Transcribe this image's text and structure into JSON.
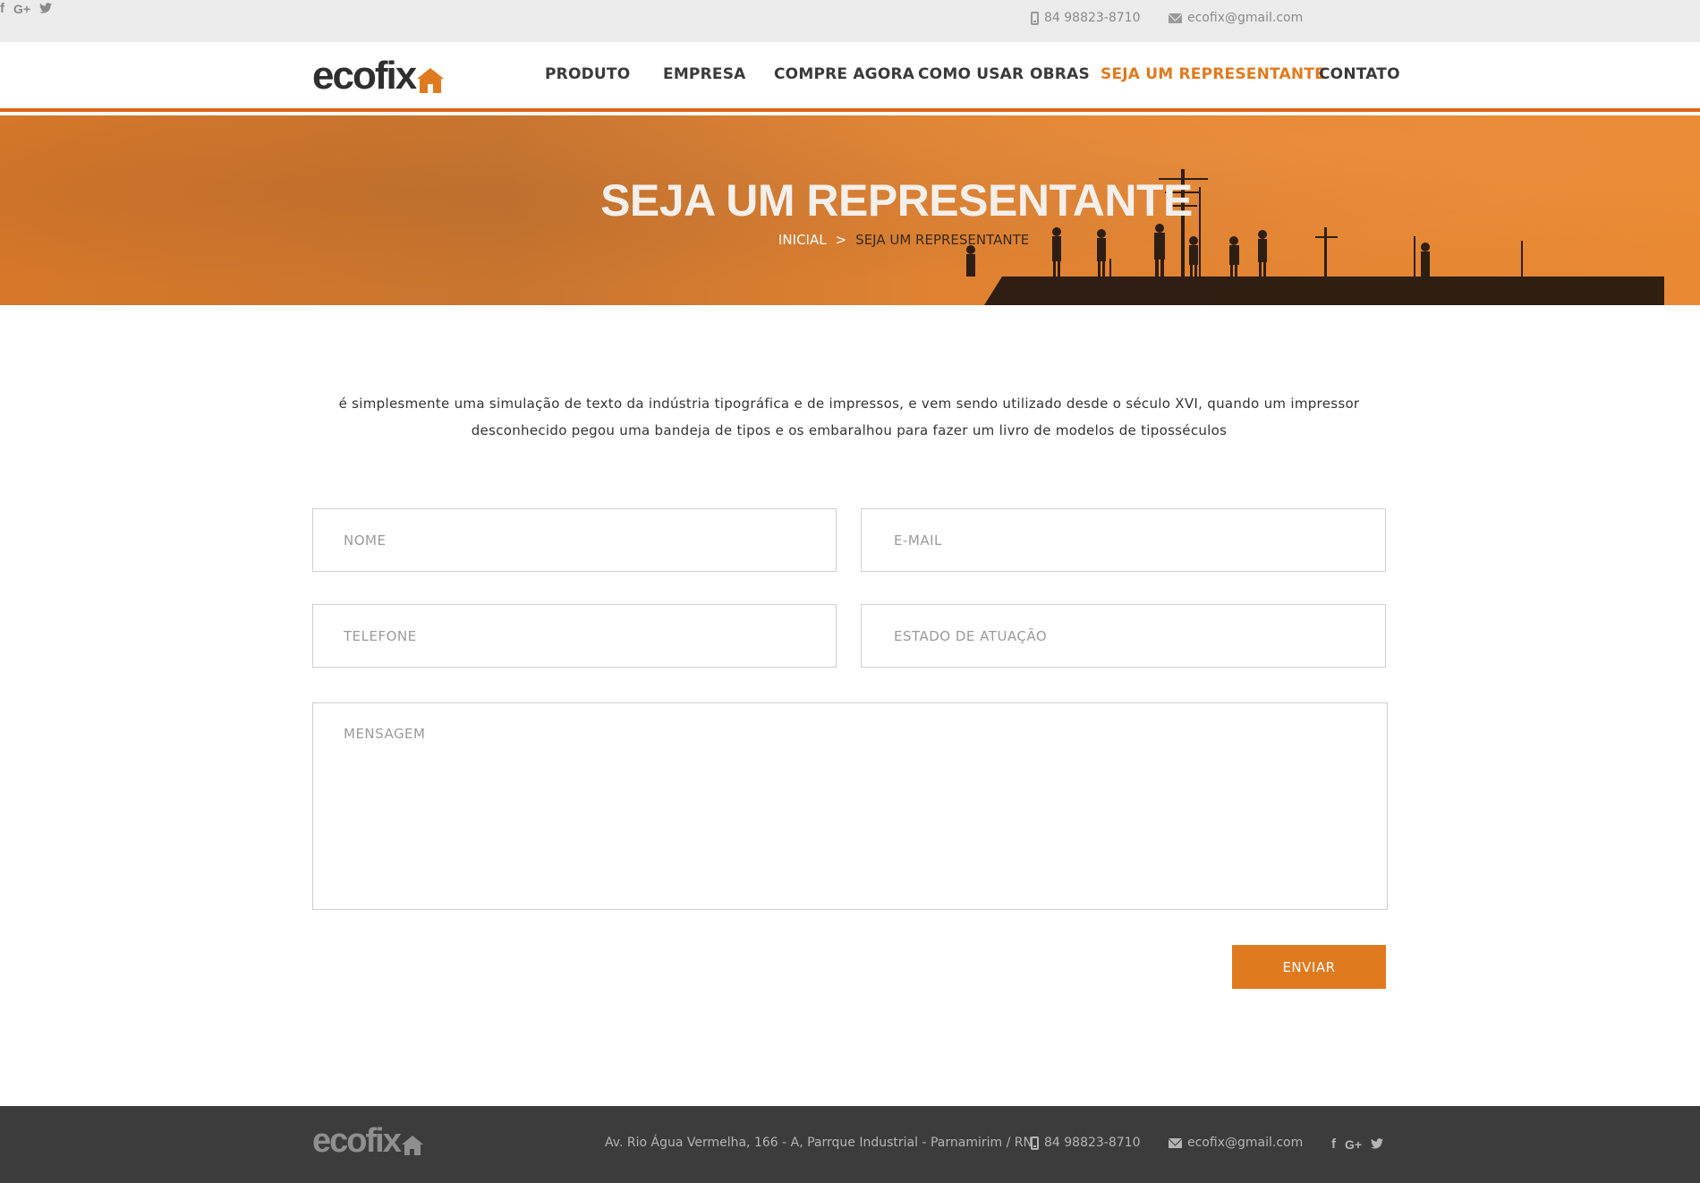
{
  "topbar": {
    "phone": "84 98823-8710",
    "email": "ecofix@gmail.com",
    "social": [
      "f",
      "G+",
      "t"
    ]
  },
  "brand": {
    "logo_text": "ecofix",
    "accent_color": "#e07a1f"
  },
  "nav": {
    "items": [
      {
        "label": "PRODUTO"
      },
      {
        "label": "EMPRESA"
      },
      {
        "label": "COMPRE AGORA"
      },
      {
        "label": "COMO USAR"
      },
      {
        "label": "OBRAS"
      },
      {
        "label": "SEJA UM REPRESENTANTE",
        "active": true
      },
      {
        "label": "CONTATO"
      }
    ]
  },
  "hero": {
    "title": "SEJA UM REPRESENTANTE",
    "breadcrumb": {
      "home": "INICIAL",
      "separator": ">",
      "current": "SEJA UM REPRESENTANTE"
    }
  },
  "intro": {
    "line1": "é simplesmente uma simulação de texto da indústria tipográfica e de impressos, e vem sendo utilizado desde o século XVI, quando um impressor",
    "line2": "desconhecido pegou uma bandeja de tipos e os embaralhou para fazer um livro de modelos de tiposséculos"
  },
  "form": {
    "nome_placeholder": "NOME",
    "email_placeholder": "E-MAIL",
    "telefone_placeholder": "TELEFONE",
    "estado_placeholder": "ESTADO DE ATUAÇÃO",
    "mensagem_placeholder": "MENSAGEM",
    "submit_label": "ENVIAR"
  },
  "footer": {
    "logo_text": "ecofix",
    "address": "Av. Rio Água Vermelha, 166 - A, Parrque Industrial - Parnamirim / RN",
    "phone": "84 98823-8710",
    "email": "ecofix@gmail.com",
    "social": [
      "f",
      "G+",
      "t"
    ]
  }
}
